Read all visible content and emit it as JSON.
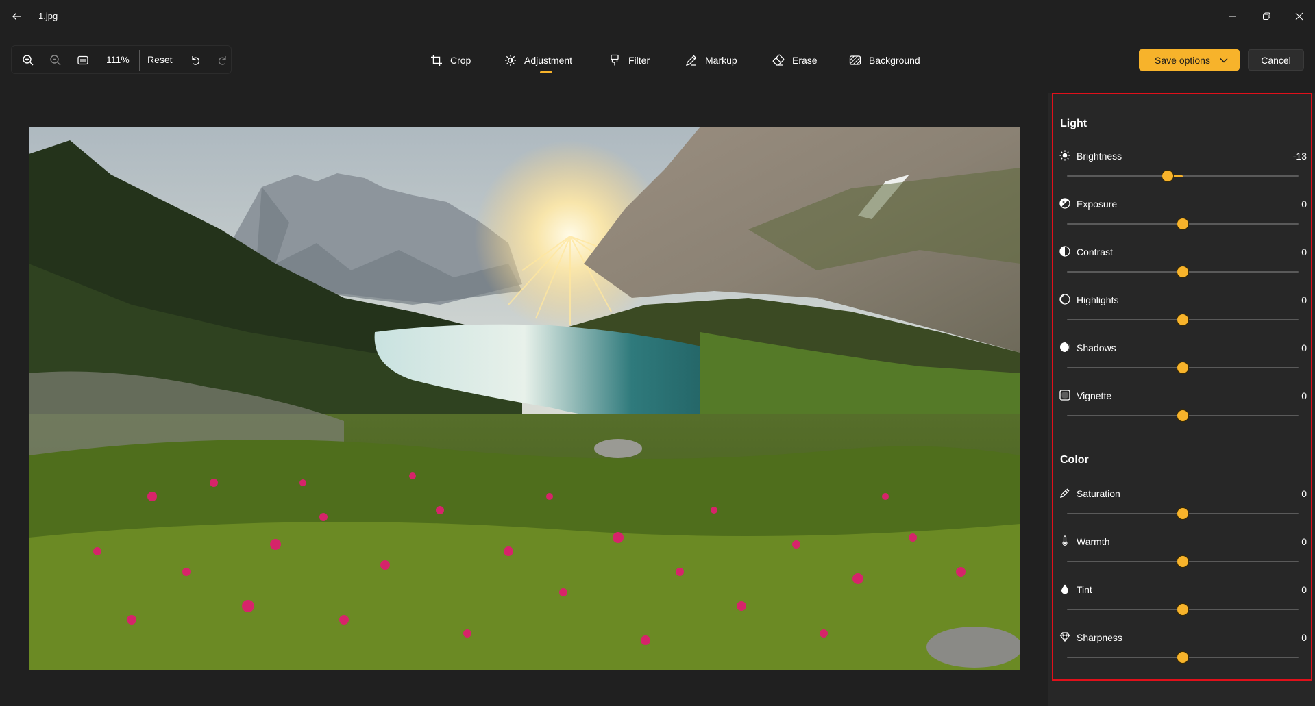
{
  "window": {
    "title": "1.jpg",
    "back_icon": "back-arrow-icon",
    "controls": [
      "minimize-icon",
      "restore-icon",
      "close-icon"
    ]
  },
  "toolbar": {
    "zoom_level": "111%",
    "reset_label": "Reset",
    "tabs": [
      {
        "label": "Crop",
        "icon": "crop-icon"
      },
      {
        "label": "Adjustment",
        "icon": "adjustment-icon",
        "active": true
      },
      {
        "label": "Filter",
        "icon": "filter-icon"
      },
      {
        "label": "Markup",
        "icon": "markup-icon"
      },
      {
        "label": "Erase",
        "icon": "erase-icon"
      },
      {
        "label": "Background",
        "icon": "background-icon"
      }
    ],
    "save_label": "Save options",
    "cancel_label": "Cancel"
  },
  "photo": {
    "description_icon": "landscape-photo",
    "colors": {
      "sky": "#c9d2d6",
      "sun": "#fff6d8",
      "mountain": "#8a8f94",
      "forest": "#2f3d22",
      "lake": "#1f5a5e",
      "flowers": "#d6246a",
      "foliage": "#6b8a2a"
    }
  },
  "panel": {
    "light_title": "Light",
    "light": [
      {
        "label": "Brightness",
        "value": "-13",
        "level": -13,
        "icon": "brightness-icon"
      },
      {
        "label": "Exposure",
        "value": "0",
        "level": 0,
        "icon": "exposure-icon"
      },
      {
        "label": "Contrast",
        "value": "0",
        "level": 0,
        "icon": "contrast-icon"
      },
      {
        "label": "Highlights",
        "value": "0",
        "level": 0,
        "icon": "highlights-icon"
      },
      {
        "label": "Shadows",
        "value": "0",
        "level": 0,
        "icon": "shadows-icon"
      },
      {
        "label": "Vignette",
        "value": "0",
        "level": 0,
        "icon": "vignette-icon"
      }
    ],
    "color_title": "Color",
    "color": [
      {
        "label": "Saturation",
        "value": "0",
        "level": 0,
        "icon": "saturation-icon"
      },
      {
        "label": "Warmth",
        "value": "0",
        "level": 0,
        "icon": "warmth-icon"
      },
      {
        "label": "Tint",
        "value": "0",
        "level": 0,
        "icon": "tint-icon"
      },
      {
        "label": "Sharpness",
        "value": "0",
        "level": 0,
        "icon": "sharpness-icon"
      }
    ],
    "slider_range": [
      -100,
      100
    ]
  },
  "colors": {
    "accent": "#f7b32b",
    "background": "#202020",
    "panel": "#272727",
    "highlight_border": "#e0101a"
  }
}
